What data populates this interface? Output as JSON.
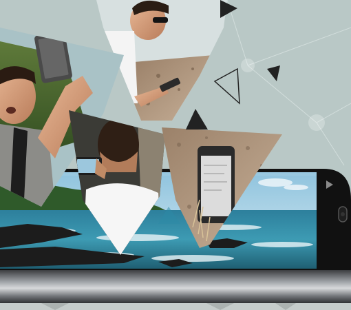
{
  "scene": {
    "background_color": "#b9c8c6",
    "accent_dark": "#222222",
    "ocean_color": "#2b8aa6",
    "sky_color": "#bfe0ef",
    "phone_body_color": "#111111",
    "phone_frame_color": "#6c6f72"
  },
  "icons": {
    "triangle_outline": "triangle-outline-icon",
    "triangle_solid": "triangle-solid-icon",
    "camera_lens": "camera-lens-icon"
  }
}
